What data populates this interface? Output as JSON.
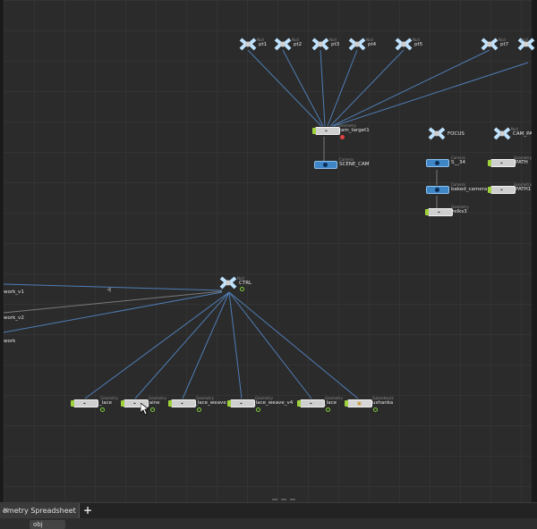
{
  "nulls_top": [
    {
      "label": "pt1",
      "cat": "Null"
    },
    {
      "label": "pt2",
      "cat": "Null"
    },
    {
      "label": "pt3",
      "cat": "Null"
    },
    {
      "label": "pt4",
      "cat": "Null"
    },
    {
      "label": "pt5",
      "cat": "Null"
    },
    {
      "label": "pt7",
      "cat": "Null"
    },
    {
      "label": "pt",
      "cat": "Null"
    }
  ],
  "cam_target": {
    "label": "cam_target1",
    "cat": "Geometry"
  },
  "scene_cam": {
    "label": "SCENE_CAM",
    "cat": "Camera"
  },
  "focus": {
    "label": "FOCUS",
    "cat": "Null"
  },
  "cam_path": {
    "label": "CAM_PATH",
    "cat": "Null"
  },
  "cam34": {
    "label": "S__34",
    "cat": "Camera"
  },
  "path": {
    "label": "PATH",
    "cat": "Geometry"
  },
  "baked_camera": {
    "label": "baked_camera",
    "cat": "Camera"
  },
  "path1": {
    "label": "PATH1",
    "cat": "Geometry"
  },
  "yelks": {
    "label": "yelks3",
    "cat": "Geometry"
  },
  "ctrl": {
    "label": "CTRL",
    "cat": "Null"
  },
  "left_labels": [
    "work_v1",
    "work_v2",
    "work"
  ],
  "bottom_nodes": [
    {
      "label": "_lace",
      "cat": "Geometry"
    },
    {
      "label": "_aine",
      "cat": "Geometry"
    },
    {
      "label": "_lace_weave",
      "cat": "Geometry"
    },
    {
      "label": "_lace_weave_v4",
      "cat": "Geometry"
    },
    {
      "label": "_lace",
      "cat": "Geometry"
    },
    {
      "label": "ushanka",
      "cat": "Subnetwork"
    }
  ],
  "tab": {
    "label": "ometry Spreadsheet",
    "close": "×",
    "add": "+"
  },
  "breadcrumb": {
    "label": "obj"
  },
  "colors": {
    "wire": "#4f7db5",
    "geo_flag": "#9fd23c",
    "camera": "#3f86c7",
    "grid_bg": "#2b2b2b"
  }
}
